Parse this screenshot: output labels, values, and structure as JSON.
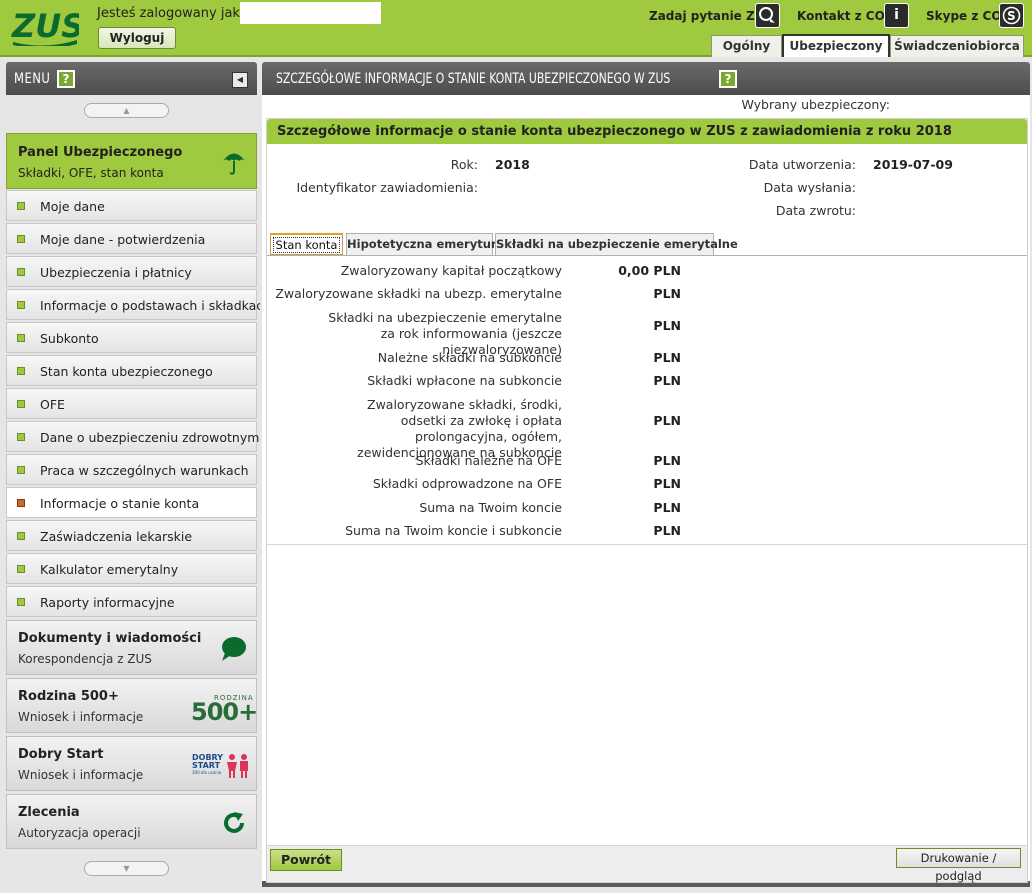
{
  "header": {
    "logo_text": "ZUS",
    "logged_in_label": "Jesteś zalogowany jako:",
    "logout_label": "Wyloguj",
    "links": [
      {
        "label": "Zadaj pytanie ZUS",
        "icon": "chat-icon"
      },
      {
        "label": "Kontakt z COT",
        "icon": "info-icon"
      },
      {
        "label": "Skype z COT",
        "icon": "skype-icon"
      }
    ],
    "tabs": [
      {
        "label": "Ogólny",
        "active": false
      },
      {
        "label": "Ubezpieczony",
        "active": true
      },
      {
        "label": "Świadczeniobiorca",
        "active": false
      }
    ]
  },
  "sidebar": {
    "menu_title": "MENU",
    "help_glyph": "?",
    "panel": {
      "title": "Panel Ubezpieczonego",
      "subtitle": "Składki, OFE, stan konta",
      "icon": "umbrella-icon"
    },
    "items": [
      {
        "label": "Moje dane"
      },
      {
        "label": "Moje dane - potwierdzenia"
      },
      {
        "label": "Ubezpieczenia i płatnicy"
      },
      {
        "label": "Informacje o podstawach i składkach"
      },
      {
        "label": "Subkonto"
      },
      {
        "label": "Stan konta ubezpieczonego"
      },
      {
        "label": "OFE"
      },
      {
        "label": "Dane o ubezpieczeniu zdrowotnym"
      },
      {
        "label": "Praca w szczególnych warunkach"
      },
      {
        "label": "Informacje o stanie konta",
        "selected": true
      },
      {
        "label": "Zaświadczenia lekarskie"
      },
      {
        "label": "Kalkulator emerytalny"
      },
      {
        "label": "Raporty informacyjne"
      }
    ],
    "panels": [
      {
        "title": "Dokumenty i wiadomości",
        "subtitle": "Korespondencja z ZUS",
        "icon": "speech-bubble-icon"
      },
      {
        "title": "Rodzina 500+",
        "subtitle": "Wniosek i informacje",
        "icon": "rodzina-500-logo",
        "logo_small": "RODZINA",
        "logo_big": "500+"
      },
      {
        "title": "Dobry Start",
        "subtitle": "Wniosek i informacje",
        "icon": "dobry-start-logo",
        "logo_line1": "DOBRY",
        "logo_line2": "START",
        "logo_line3": "300 dla ucznia"
      },
      {
        "title": "Zlecenia",
        "subtitle": "Autoryzacja operacji",
        "icon": "refresh-icon"
      }
    ]
  },
  "main": {
    "page_title": "SZCZEGÓŁOWE INFORMACJE O STANIE KONTA UBEZPIECZONEGO W ZUS",
    "help_glyph": "?",
    "selected_insured_label": "Wybrany ubezpieczony:",
    "section_title": "Szczegółowe informacje o stanie konta ubezpieczonego w ZUS z zawiadomienia z roku 2018",
    "info": {
      "year_label": "Rok:",
      "year_value": "2018",
      "notice_id_label": "Identyfikator zawiadomienia:",
      "created_label": "Data utworzenia:",
      "created_value": "2019-07-09",
      "sent_label": "Data wysłania:",
      "returned_label": "Data zwrotu:"
    },
    "tabs": [
      {
        "label": "Stan konta",
        "active": true
      },
      {
        "label": "Hipotetyczna emerytura",
        "active": false
      },
      {
        "label": "Składki na ubezpieczenie emerytalne",
        "active": false
      }
    ],
    "rows": [
      {
        "label": "Zwaloryzowany kapitał początkowy",
        "value": "0,00 PLN"
      },
      {
        "label": "Zwaloryzowane składki na ubezp. emerytalne",
        "value": "PLN"
      },
      {
        "label": "Składki na ubezpieczenie emerytalne za rok informowania (jeszcze niezwaloryzowane)",
        "value": "PLN"
      },
      {
        "label": "Należne składki na subkoncie",
        "value": "PLN"
      },
      {
        "label": "Składki wpłacone na subkoncie",
        "value": "PLN"
      },
      {
        "label": "Zwaloryzowane składki, środki, odsetki za zwłokę i opłata prolongacyjna, ogółem, zewidencjonowane na subkoncie",
        "value": "PLN"
      },
      {
        "label": "Składki należne na OFE",
        "value": "PLN"
      },
      {
        "label": "Składki odprowadzone na OFE",
        "value": "PLN"
      },
      {
        "label": "Suma na Twoim koncie",
        "value": "PLN"
      },
      {
        "label": "Suma na Twoim koncie i subkoncie",
        "value": "PLN"
      }
    ],
    "back_label": "Powrót",
    "print_label": "Drukowanie / podgląd"
  },
  "colors": {
    "brand_green": "#9fc93e",
    "dark_header": "#555555",
    "logo_green": "#0b6b2f"
  }
}
